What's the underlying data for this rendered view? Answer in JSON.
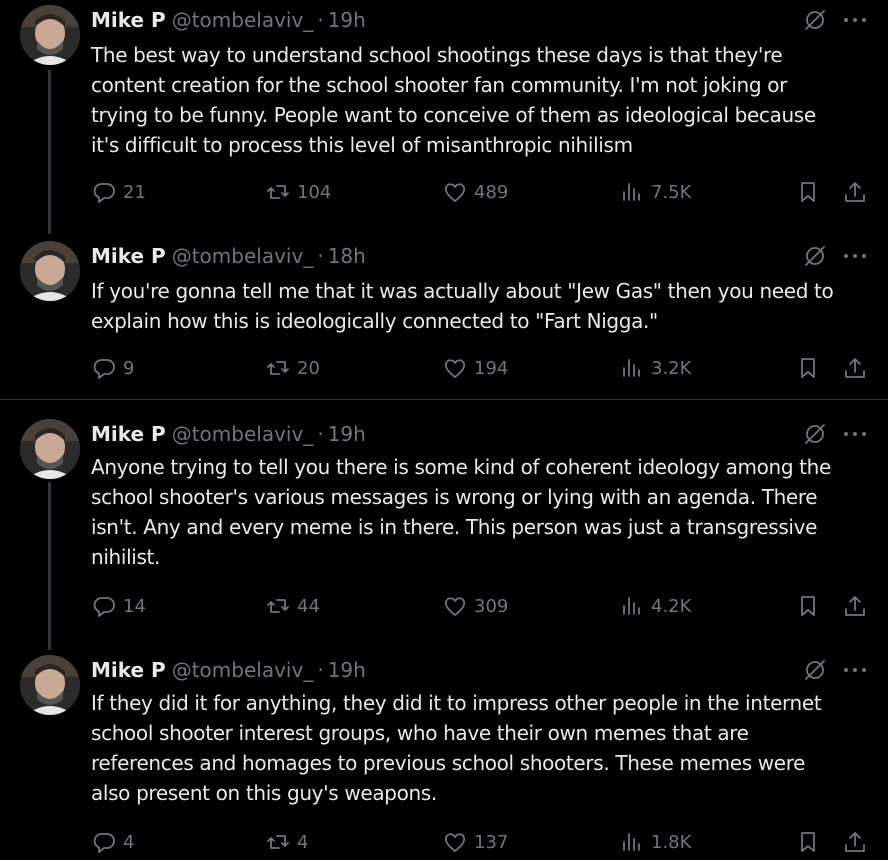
{
  "tweets": [
    {
      "name": "Mike P",
      "handle": "@tombelaviv_",
      "dot": "·",
      "time": "19h",
      "text": "The best way to understand school shootings these days is that they're\ncontent creation for the school shooter fan community. I'm not joking or\ntrying to be funny. People want to conceive of them as ideological because\nit's difficult to process this level of misanthropic nihilism",
      "replies": "21",
      "reposts": "104",
      "likes": "489",
      "views": "7.5K"
    },
    {
      "name": "Mike P",
      "handle": "@tombelaviv_",
      "dot": "·",
      "time": "18h",
      "text": "If you're gonna tell me that it was actually about \"Jew Gas\" then you need to\nexplain how this is ideologically connected to \"Fart Nigga.\"",
      "replies": "9",
      "reposts": "20",
      "likes": "194",
      "views": "3.2K"
    },
    {
      "name": "Mike P",
      "handle": "@tombelaviv_",
      "dot": "·",
      "time": "19h",
      "text": "Anyone trying to tell you there is some kind of coherent ideology among the\nschool shooter's various messages is wrong or lying with an agenda. There\nisn't. Any and every meme is in there. This person was just a transgressive\nnihilist.",
      "replies": "14",
      "reposts": "44",
      "likes": "309",
      "views": "4.2K"
    },
    {
      "name": "Mike P",
      "handle": "@tombelaviv_",
      "dot": "·",
      "time": "19h",
      "text": "If they did it for anything, they did it to impress other people in the internet\nschool shooter interest groups, who have their own memes that are\nreferences and homages to previous school shooters. These memes were\nalso present on this guy's weapons.",
      "replies": "4",
      "reposts": "4",
      "likes": "137",
      "views": "1.8K"
    }
  ],
  "icons": {
    "reply": "reply-icon",
    "repost": "repost-icon",
    "like": "heart-icon",
    "views": "views-icon",
    "bookmark": "bookmark-icon",
    "share": "share-icon",
    "grok": "grok-icon",
    "more": "more-icon"
  },
  "colors": {
    "background": "#000000",
    "text": "#e7e9ea",
    "muted": "#71767b",
    "divider": "#2f3336"
  }
}
